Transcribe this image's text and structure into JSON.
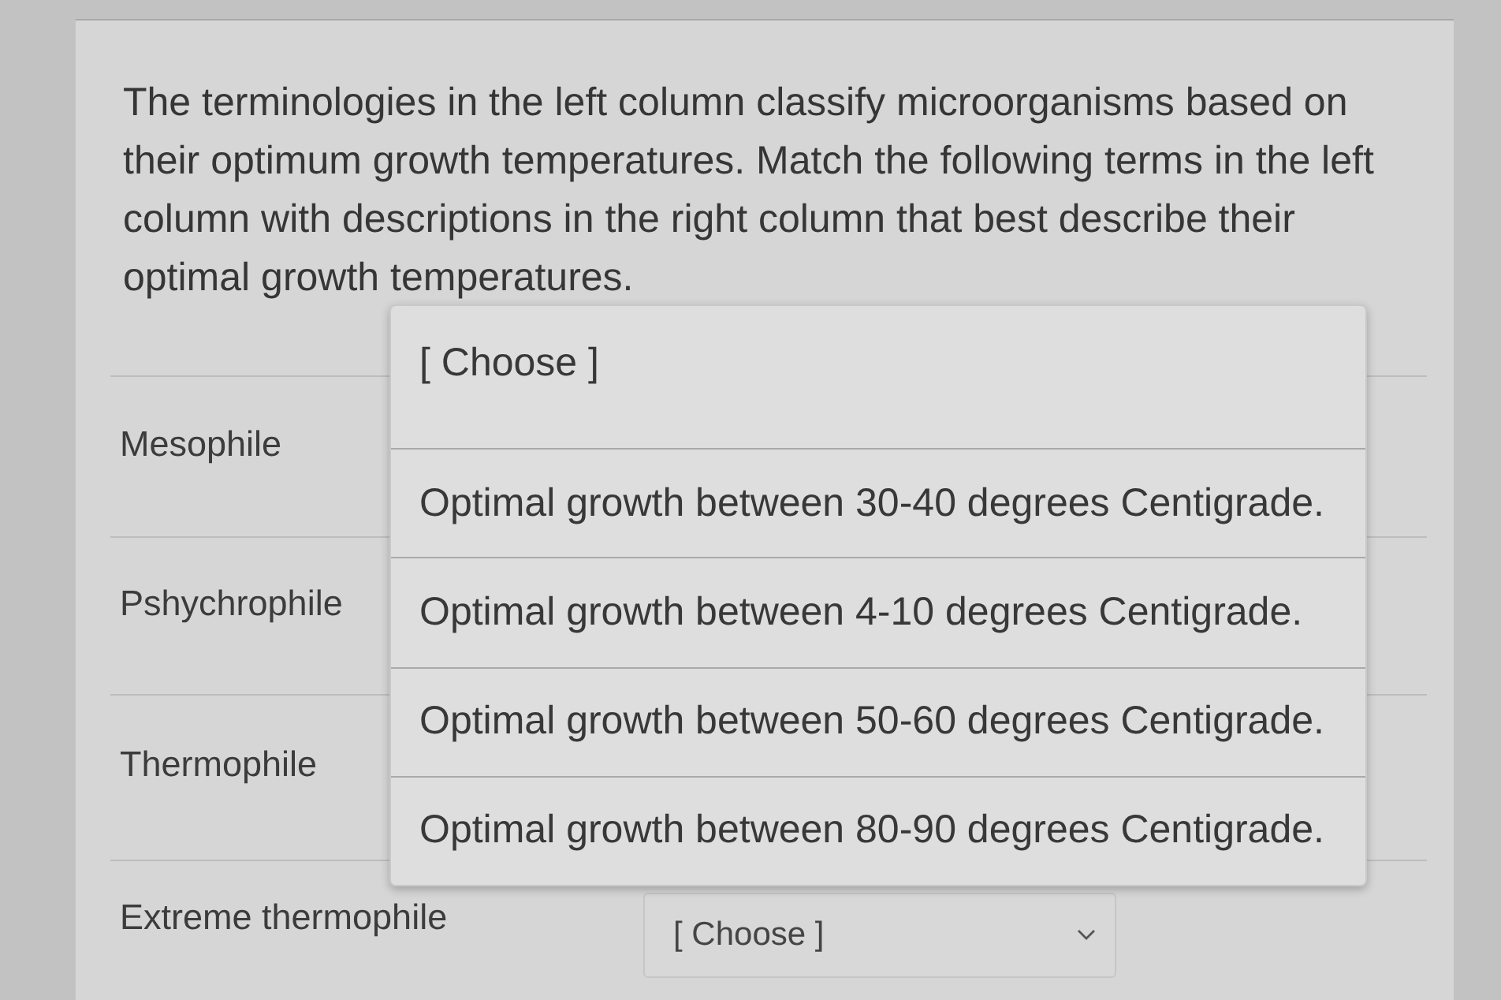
{
  "question": {
    "text": "The terminologies in the left column classify microorganisms based on their optimum growth temperatures. Match the following terms in the left column with descriptions in the right column that best describe their optimal growth temperatures."
  },
  "matches": [
    {
      "term": "Mesophile"
    },
    {
      "term": "Pshychrophile"
    },
    {
      "term": "Thermophile"
    },
    {
      "term": "Extreme thermophile",
      "select": {
        "value": "[ Choose ]"
      }
    }
  ],
  "open_dropdown": {
    "options": [
      {
        "label": "[ Choose ]",
        "selected": false
      },
      {
        "label": "Optimal growth between 30-40 degrees Centigrade.",
        "selected": false
      },
      {
        "label": "Optimal growth between 4-10 degrees Centigrade.",
        "selected": false
      },
      {
        "label": "Optimal growth between 50-60 degrees Centigrade.",
        "selected": false
      },
      {
        "label": "Optimal growth between 80-90 degrees Centigrade.",
        "selected": false
      }
    ]
  }
}
